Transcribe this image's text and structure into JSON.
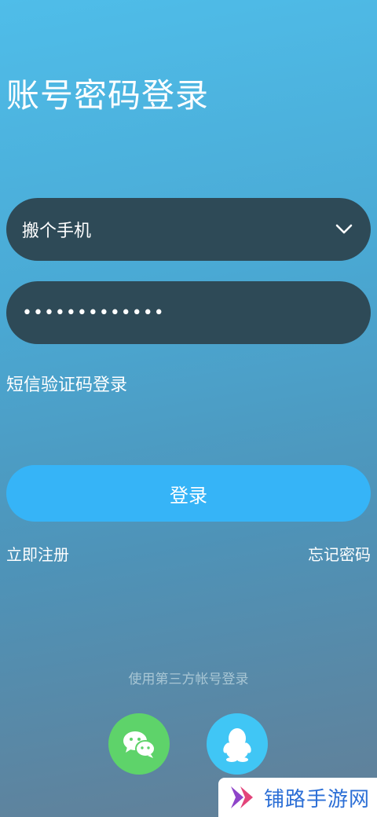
{
  "page": {
    "title": "账号密码登录"
  },
  "form": {
    "account_value": "搬个手机",
    "password_value": "•••••••••••••",
    "sms_login_link": "短信验证码登录",
    "login_button": "登录",
    "register_link": "立即注册",
    "forgot_link": "忘记密码"
  },
  "third_party": {
    "label": "使用第三方帐号登录",
    "providers": [
      {
        "name": "wechat",
        "icon": "wechat-icon",
        "color": "#5ed36a"
      },
      {
        "name": "qq",
        "icon": "qq-penguin-icon",
        "color": "#40c6f5"
      }
    ]
  },
  "watermark": {
    "text": "铺路手游网"
  },
  "colors": {
    "field_bg": "#2e4a57",
    "button_bg": "#36b4f7"
  }
}
